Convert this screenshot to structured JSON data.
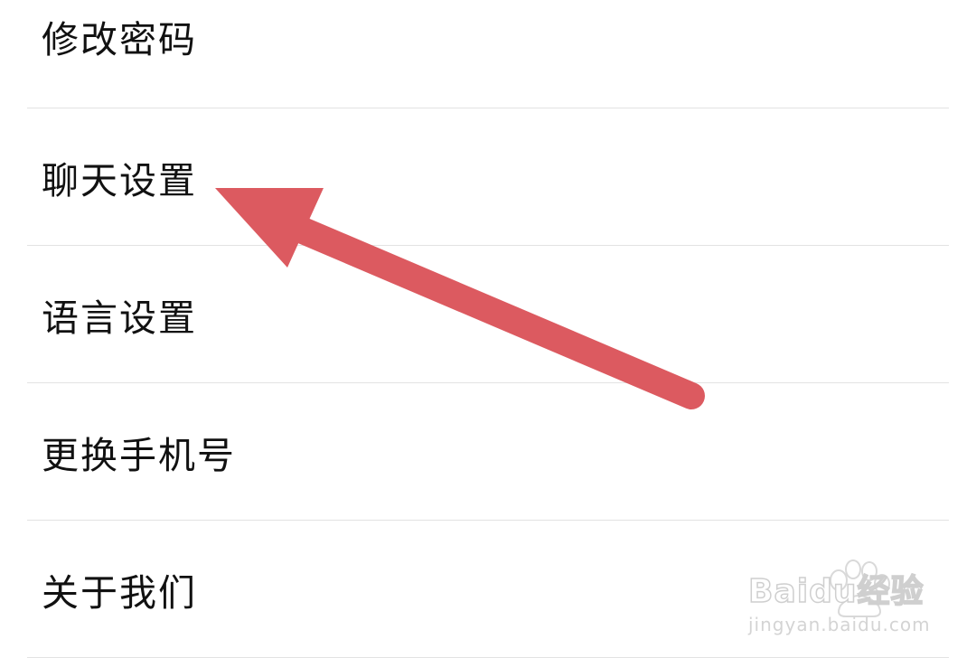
{
  "menu": {
    "items": [
      {
        "label": "修改密码"
      },
      {
        "label": "聊天设置"
      },
      {
        "label": "语言设置"
      },
      {
        "label": "更换手机号"
      },
      {
        "label": "关于我们"
      }
    ]
  },
  "annotation": {
    "arrow_color": "#dc5a60",
    "arrow_target": "聊天设置"
  },
  "watermark": {
    "brand": "Baidu经验",
    "url": "jingyan.baidu.com"
  }
}
